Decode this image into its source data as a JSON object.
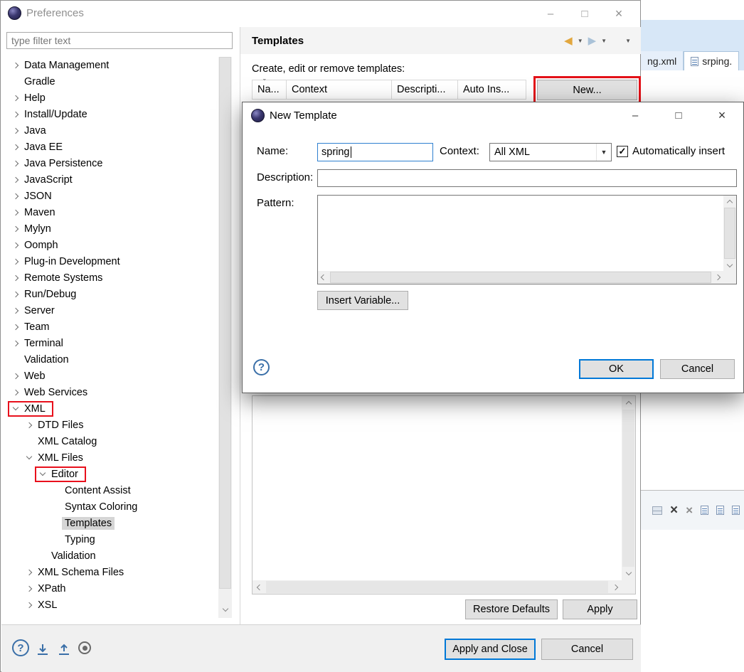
{
  "app": {
    "title": "Preferences"
  },
  "glyphs": {
    "minimize": "–",
    "maximize": "□",
    "close": "×",
    "back": "◀",
    "forward": "▶",
    "menu_arrow": "▼",
    "sort": "ˇ",
    "check": "✓",
    "help": "?",
    "delete_x": "×",
    "delete_all_x": "×"
  },
  "filter": {
    "placeholder": "type filter text"
  },
  "tree": {
    "items": [
      {
        "label": "Data Management",
        "arrow": "collapsed",
        "level": 0
      },
      {
        "label": "Gradle",
        "arrow": "none",
        "level": 0
      },
      {
        "label": "Help",
        "arrow": "collapsed",
        "level": 0
      },
      {
        "label": "Install/Update",
        "arrow": "collapsed",
        "level": 0
      },
      {
        "label": "Java",
        "arrow": "collapsed",
        "level": 0
      },
      {
        "label": "Java EE",
        "arrow": "collapsed",
        "level": 0
      },
      {
        "label": "Java Persistence",
        "arrow": "collapsed",
        "level": 0
      },
      {
        "label": "JavaScript",
        "arrow": "collapsed",
        "level": 0
      },
      {
        "label": "JSON",
        "arrow": "collapsed",
        "level": 0
      },
      {
        "label": "Maven",
        "arrow": "collapsed",
        "level": 0
      },
      {
        "label": "Mylyn",
        "arrow": "collapsed",
        "level": 0
      },
      {
        "label": "Oomph",
        "arrow": "collapsed",
        "level": 0
      },
      {
        "label": "Plug-in Development",
        "arrow": "collapsed",
        "level": 0
      },
      {
        "label": "Remote Systems",
        "arrow": "collapsed",
        "level": 0
      },
      {
        "label": "Run/Debug",
        "arrow": "collapsed",
        "level": 0
      },
      {
        "label": "Server",
        "arrow": "collapsed",
        "level": 0
      },
      {
        "label": "Team",
        "arrow": "collapsed",
        "level": 0
      },
      {
        "label": "Terminal",
        "arrow": "collapsed",
        "level": 0
      },
      {
        "label": "Validation",
        "arrow": "none",
        "level": 0
      },
      {
        "label": "Web",
        "arrow": "collapsed",
        "level": 0
      },
      {
        "label": "Web Services",
        "arrow": "collapsed",
        "level": 0
      },
      {
        "label": "XML",
        "arrow": "expanded",
        "level": 0,
        "annotated": true
      },
      {
        "label": "DTD Files",
        "arrow": "collapsed",
        "level": 1
      },
      {
        "label": "XML Catalog",
        "arrow": "none",
        "level": 1
      },
      {
        "label": "XML Files",
        "arrow": "expanded",
        "level": 1
      },
      {
        "label": "Editor",
        "arrow": "expanded",
        "level": 2,
        "annotated": true
      },
      {
        "label": "Content Assist",
        "arrow": "none",
        "level": 3
      },
      {
        "label": "Syntax Coloring",
        "arrow": "none",
        "level": 3
      },
      {
        "label": "Templates",
        "arrow": "none",
        "level": 3,
        "selected": true
      },
      {
        "label": "Typing",
        "arrow": "none",
        "level": 3
      },
      {
        "label": "Validation",
        "arrow": "none",
        "level": 2
      },
      {
        "label": "XML Schema Files",
        "arrow": "collapsed",
        "level": 1
      },
      {
        "label": "XPath",
        "arrow": "collapsed",
        "level": 1
      },
      {
        "label": "XSL",
        "arrow": "collapsed",
        "level": 1
      }
    ]
  },
  "templates_page": {
    "title": "Templates",
    "instruction": "Create, edit or remove templates:",
    "columns": [
      "Na...",
      "Context",
      "Descripti...",
      "Auto Ins..."
    ],
    "new_button": "New...",
    "restore_defaults_button": "Restore Defaults",
    "apply_button": "Apply"
  },
  "footer": {
    "apply_and_close_button": "Apply and Close",
    "cancel_button": "Cancel"
  },
  "dialog": {
    "title": "New Template",
    "fields": {
      "name_label": "Name:",
      "name_value": "spring",
      "context_label": "Context:",
      "context_value": "All XML",
      "auto_insert_label": "Automatically insert",
      "auto_insert_checked": true,
      "description_label": "Description:",
      "description_value": "",
      "pattern_label": "Pattern:",
      "pattern_value": ""
    },
    "buttons": {
      "insert_variable": "Insert Variable...",
      "ok": "OK",
      "cancel": "Cancel"
    }
  },
  "background_editor": {
    "tabs": [
      {
        "label": "ng.xml",
        "selected": false,
        "icon": false
      },
      {
        "label": "srping.",
        "selected": true,
        "icon": true
      }
    ]
  },
  "colors": {
    "annotation": "#e31219",
    "focus_border": "#0078d7",
    "selection_bg": "#d5d5d5"
  }
}
